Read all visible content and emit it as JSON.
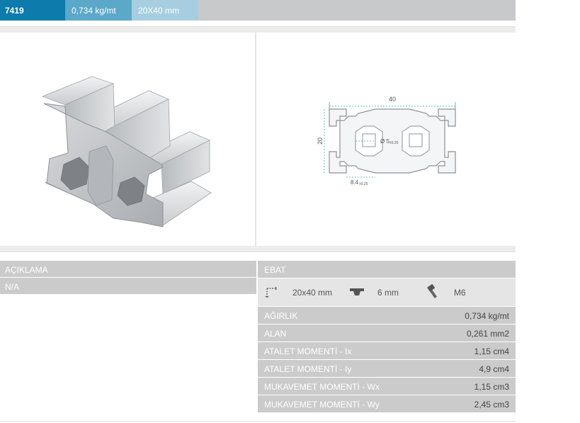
{
  "header": {
    "code": "7419",
    "weight": "0,734 kg/mt",
    "size": "20X40 mm"
  },
  "drawing": {
    "dim_width": "40",
    "dim_height": "20",
    "dim_hole": "Ø 5",
    "dim_hole_tol": "±0.25",
    "dim_slot": "8.4",
    "dim_slot_tol": "±0.25"
  },
  "description": {
    "label": "AÇIKLAMA",
    "value": "N/A"
  },
  "specs": {
    "label": "EBAT",
    "dimensions": "20x40 mm",
    "slot": "6 mm",
    "bolt": "M6",
    "icons": [
      "dimension-icon",
      "t-slot-nut-icon",
      "bolt-icon"
    ],
    "properties": [
      {
        "key": "AĞIRLIK",
        "value": "0,734 kg/mt"
      },
      {
        "key": "ALAN",
        "value": "0,261 mm2"
      },
      {
        "key": "ATALET MOMENTİ - Ix",
        "value": "1,15 cm4"
      },
      {
        "key": "ATALET MOMENTİ - Iy",
        "value": "4,9 cm4"
      },
      {
        "key": "MUKAVEMET MOMENTİ - Wx",
        "value": "1,15 cm3"
      },
      {
        "key": "MUKAVEMET MOMENTİ - Wy",
        "value": "2,45 cm3"
      }
    ]
  },
  "colors": {
    "accent_dark": "#0d7bab",
    "accent_mid": "#5ba8c8",
    "accent_light": "#a6cee0",
    "panel_grey": "#cbcbcb",
    "dimension_teal": "#3aa9a0"
  }
}
